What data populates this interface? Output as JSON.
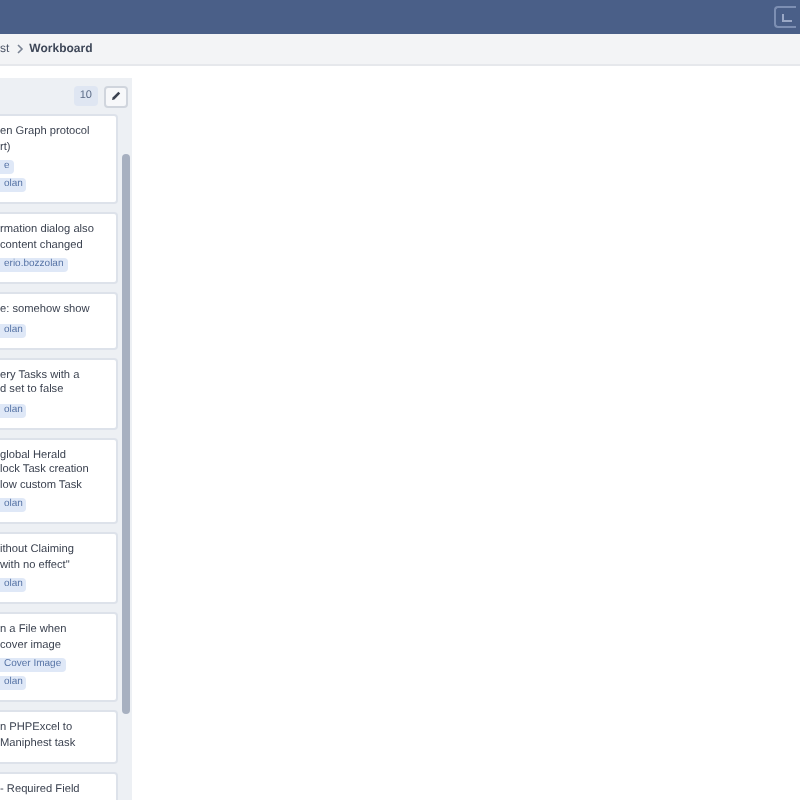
{
  "breadcrumbs": [
    {
      "label": "st",
      "current": false
    },
    {
      "label": "Workboard",
      "current": true
    }
  ],
  "column": {
    "count": "10",
    "cards": [
      {
        "lines": [
          "en Graph protocol",
          "rt)"
        ],
        "tags": [
          "e",
          "olan"
        ]
      },
      {
        "lines": [
          "rmation dialog also",
          "content changed"
        ],
        "tags": [
          "erio.bozzolan"
        ]
      },
      {
        "lines": [
          "e: somehow show"
        ],
        "tags": [
          "olan"
        ]
      },
      {
        "lines": [
          "ery Tasks with a",
          "d set to false"
        ],
        "tags": [
          "olan"
        ]
      },
      {
        "lines": [
          "global Herald",
          "lock Task creation",
          "low custom Task"
        ],
        "tags": [
          "olan"
        ]
      },
      {
        "lines": [
          "ithout Claiming",
          " with no effect\""
        ],
        "tags": [
          "olan"
        ]
      },
      {
        "lines": [
          "n a File when",
          "cover image"
        ],
        "tags": [
          "Cover Image",
          "olan"
        ]
      },
      {
        "lines": [
          "n PHPExcel to",
          " Maniphest task"
        ]
      },
      {
        "lines": [
          "- Required Field"
        ]
      }
    ]
  }
}
